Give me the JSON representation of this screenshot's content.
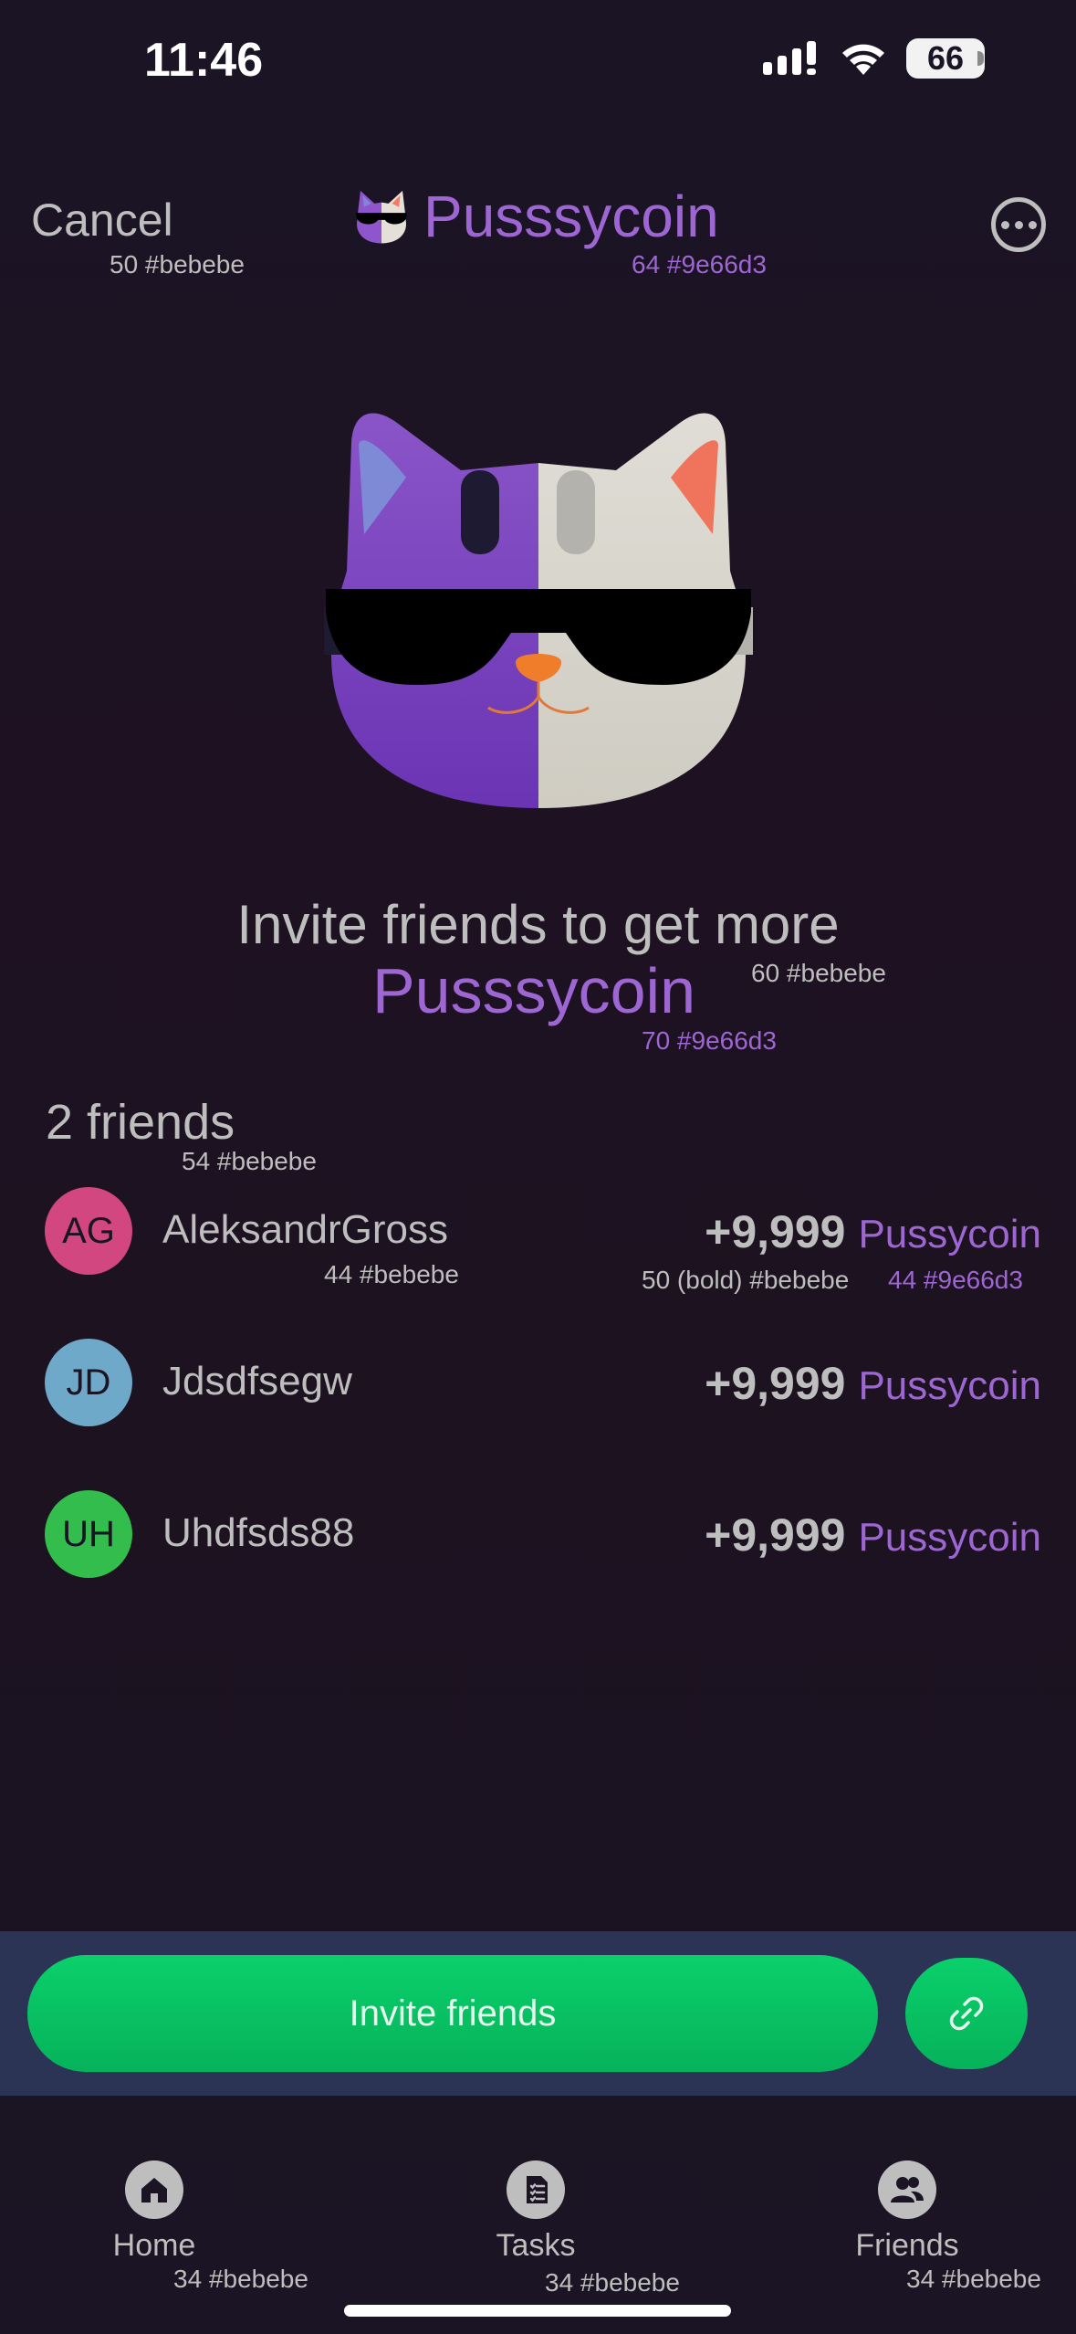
{
  "status_bar": {
    "time": "11:46",
    "battery": "66"
  },
  "header": {
    "cancel_label": "Cancel",
    "cancel_spec": "50 #bebebe",
    "title": "Pusssycoin",
    "title_spec": "64 #9e66d3"
  },
  "hero": {
    "invite_line1": "Invite friends to get more",
    "invite_line2": "Pusssycoin",
    "spec1": "60 #bebebe",
    "spec2": "70 #9e66d3"
  },
  "friends": {
    "count_label": "2 friends",
    "count_spec": "54 #bebebe",
    "items": [
      {
        "initials": "AG",
        "avatar_color": "#d2477f",
        "name": "AleksandrGross",
        "amount": "+9,999",
        "coin": "Pussycoin"
      },
      {
        "initials": "JD",
        "avatar_color": "#6fa9ca",
        "name": "Jdsdfsegw",
        "amount": "+9,999",
        "coin": "Pussycoin"
      },
      {
        "initials": "UH",
        "avatar_color": "#33bd4c",
        "name": "Uhdfsds88",
        "amount": "+9,999",
        "coin": "Pussycoin"
      }
    ],
    "name_spec": "44 #bebebe",
    "amount_spec": "50 (bold) #bebebe",
    "coin_spec": "44 #9e66d3"
  },
  "actions": {
    "invite_label": "Invite friends"
  },
  "tabs": [
    {
      "label": "Home",
      "spec": "34 #bebebe"
    },
    {
      "label": "Tasks",
      "spec": "34 #bebebe"
    },
    {
      "label": "Friends",
      "spec": "34 #bebebe"
    }
  ],
  "colors": {
    "accent": "#9e66d3",
    "text": "#bebebe",
    "green": "#08c263",
    "bar": "#2c3456"
  }
}
